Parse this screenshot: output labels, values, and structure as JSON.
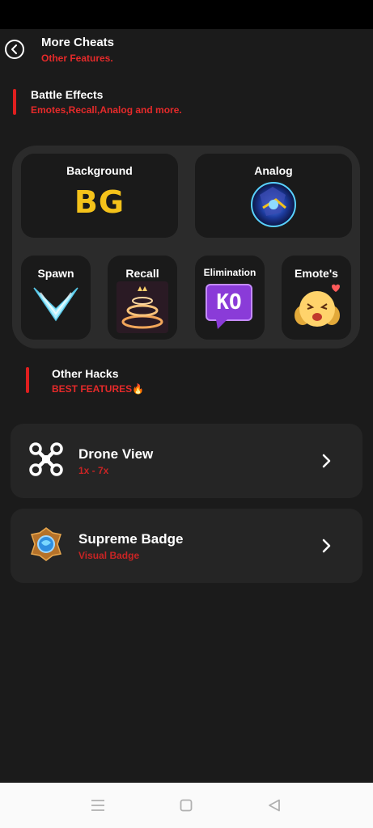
{
  "header": {
    "title": "More Cheats",
    "subtitle": "Other Features."
  },
  "battle_section": {
    "title": "Battle Effects",
    "subtitle": "Emotes,Recall,Analog and more."
  },
  "tiles": {
    "background": {
      "label": "Background",
      "glyph": "BG"
    },
    "analog": {
      "label": "Analog"
    },
    "spawn": {
      "label": "Spawn"
    },
    "recall": {
      "label": "Recall"
    },
    "elimination": {
      "label": "Elimination",
      "glyph": "KO"
    },
    "emotes": {
      "label": "Emote's"
    }
  },
  "other_section": {
    "title": "Other Hacks",
    "subtitle": "BEST FEATURES🔥"
  },
  "cards": [
    {
      "title": "Drone View",
      "subtitle": "1x - 7x",
      "icon": "drone-icon"
    },
    {
      "title": "Supreme Badge",
      "subtitle": "Visual Badge",
      "icon": "supreme-badge-icon"
    }
  ],
  "colors": {
    "accent": "#e01f1f",
    "background": "#1b1b1b",
    "card": "#252525",
    "tile": "#1a1a1a",
    "panel": "#2b2b2b"
  }
}
